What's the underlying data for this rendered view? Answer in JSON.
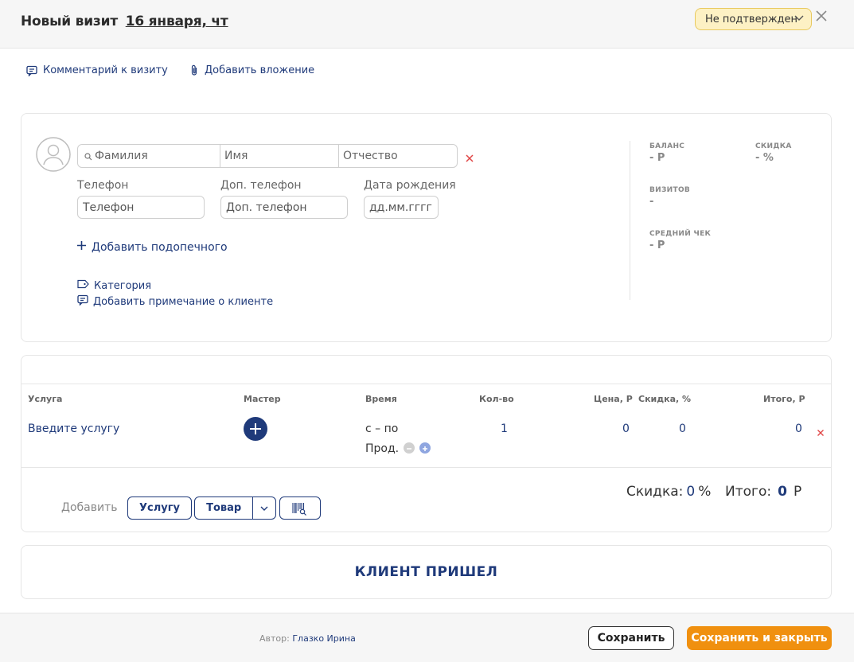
{
  "header": {
    "title": "Новый визит",
    "date": "16 января, чт",
    "status": "Не подтвержден"
  },
  "top_links": {
    "comment": "Комментарий к визиту",
    "attachment": "Добавить вложение"
  },
  "client": {
    "surname_placeholder": "Фамилия",
    "name_placeholder": "Имя",
    "patronymic_placeholder": "Отчество",
    "phone_label": "Телефон",
    "phone_placeholder": "Телефон",
    "extra_phone_label": "Доп. телефон",
    "extra_phone_placeholder": "Доп. телефон",
    "birthdate_label": "Дата рождения",
    "birthdate_placeholder": "дд.мм.гггг",
    "add_ward": "Добавить подопечного",
    "category": "Категория",
    "add_note": "Добавить примечание о клиенте"
  },
  "stats": {
    "balance_label": "БАЛАНС",
    "balance_value": "- Р",
    "discount_label": "СКИДКА",
    "discount_value": "- %",
    "visits_label": "ВИЗИТОВ",
    "visits_value": "-",
    "avg_check_label": "СРЕДНИЙ ЧЕК",
    "avg_check_value": "- Р"
  },
  "services_table": {
    "columns": [
      "Услуга",
      "Мастер",
      "Время",
      "Кол-во",
      "Цена, Р",
      "Скидка, %",
      "Итого, Р"
    ],
    "row": {
      "service": "Введите услугу",
      "time": "с – по",
      "prod": "Прод.",
      "qty": "1",
      "price": "0",
      "discount": "0",
      "total": "0"
    }
  },
  "add_bar": {
    "label": "Добавить",
    "service_btn": "Услугу",
    "product_btn": "Товар"
  },
  "summary": {
    "discount_label": "Скидка:",
    "discount_value": "0",
    "discount_unit": "%",
    "total_label": "Итого:",
    "total_value": "0",
    "total_unit": "Р"
  },
  "client_arrived": "КЛИЕНТ ПРИШЕЛ",
  "footer": {
    "author_label": "Автор:",
    "author_name": "Глазко Ирина",
    "save": "Сохранить",
    "save_close": "Сохранить и закрыть"
  },
  "colors": {
    "accent": "#1f3a7a",
    "primary_button": "#f0900f",
    "status_bg": "#fdf1c4",
    "danger": "#e04545"
  }
}
